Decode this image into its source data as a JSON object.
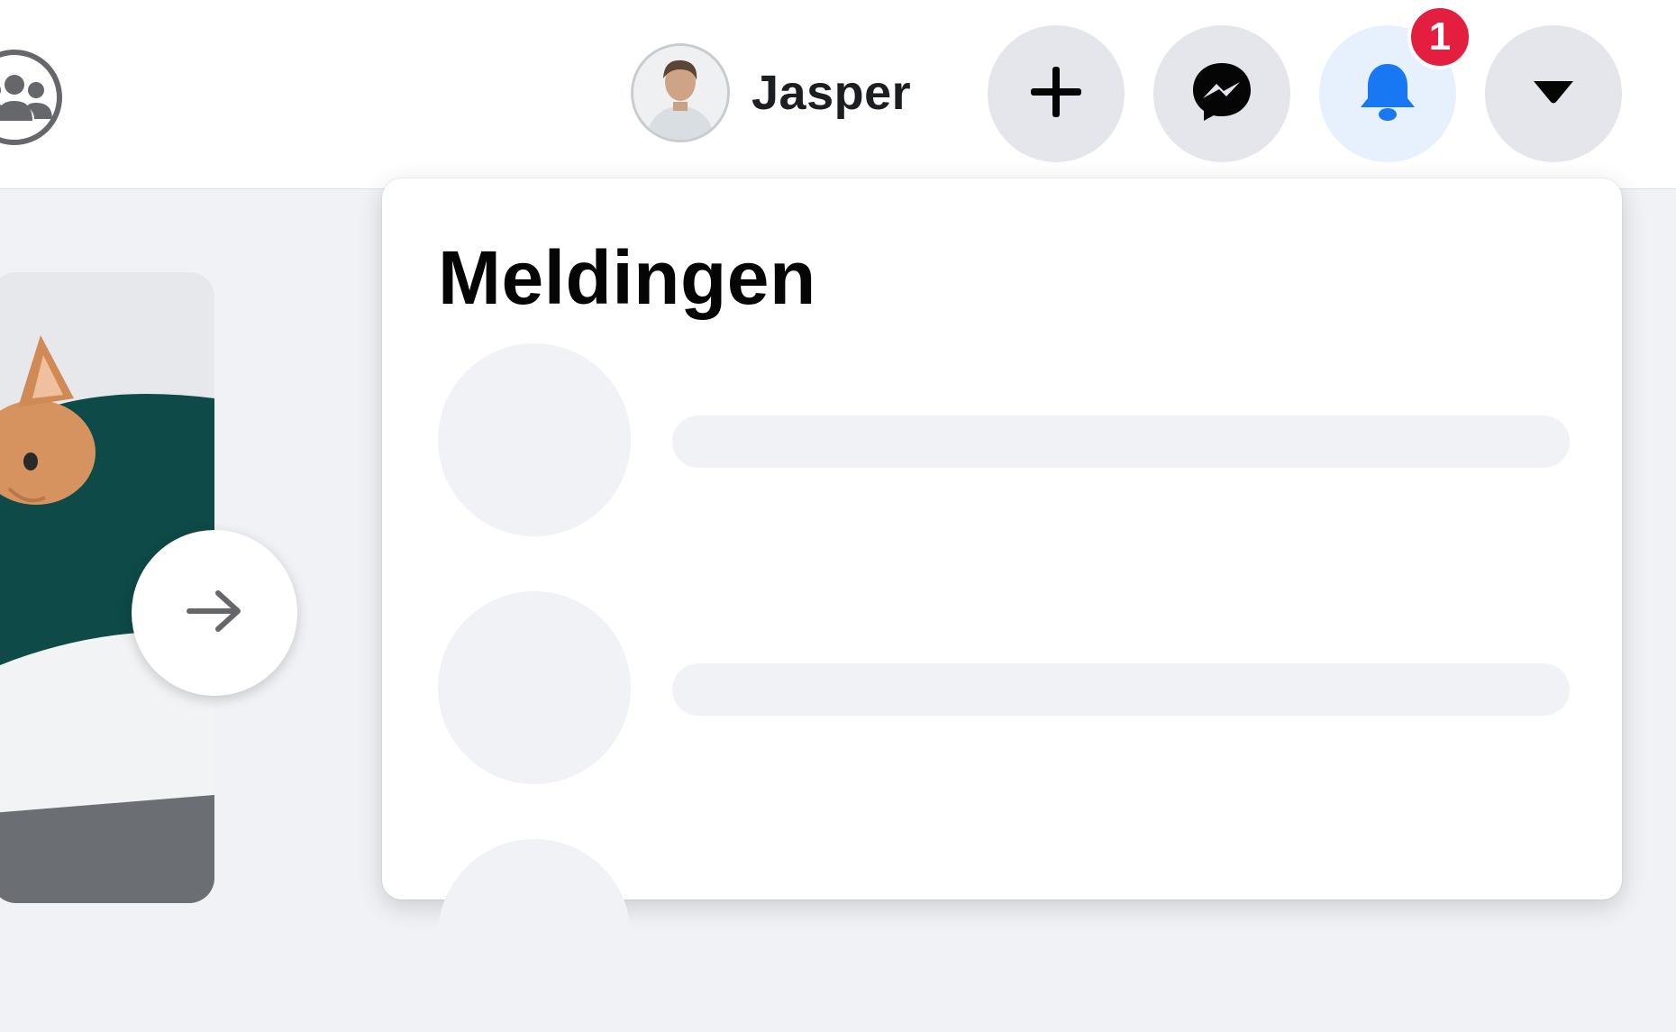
{
  "header": {
    "groups_icon": "groups-icon",
    "profile_name": "Jasper",
    "create_icon": "plus-icon",
    "messenger_icon": "messenger-icon",
    "notifications_icon": "bell-icon",
    "notifications_badge": "1",
    "account_icon": "caret-down-icon"
  },
  "story": {
    "next_icon": "arrow-right-icon"
  },
  "notifications_panel": {
    "title": "Meldingen"
  },
  "colors": {
    "accent": "#1877f2",
    "badge": "#e41e3f",
    "background": "#f0f2f5",
    "button": "#e4e6eb",
    "placeholder": "#f0f2f5"
  }
}
